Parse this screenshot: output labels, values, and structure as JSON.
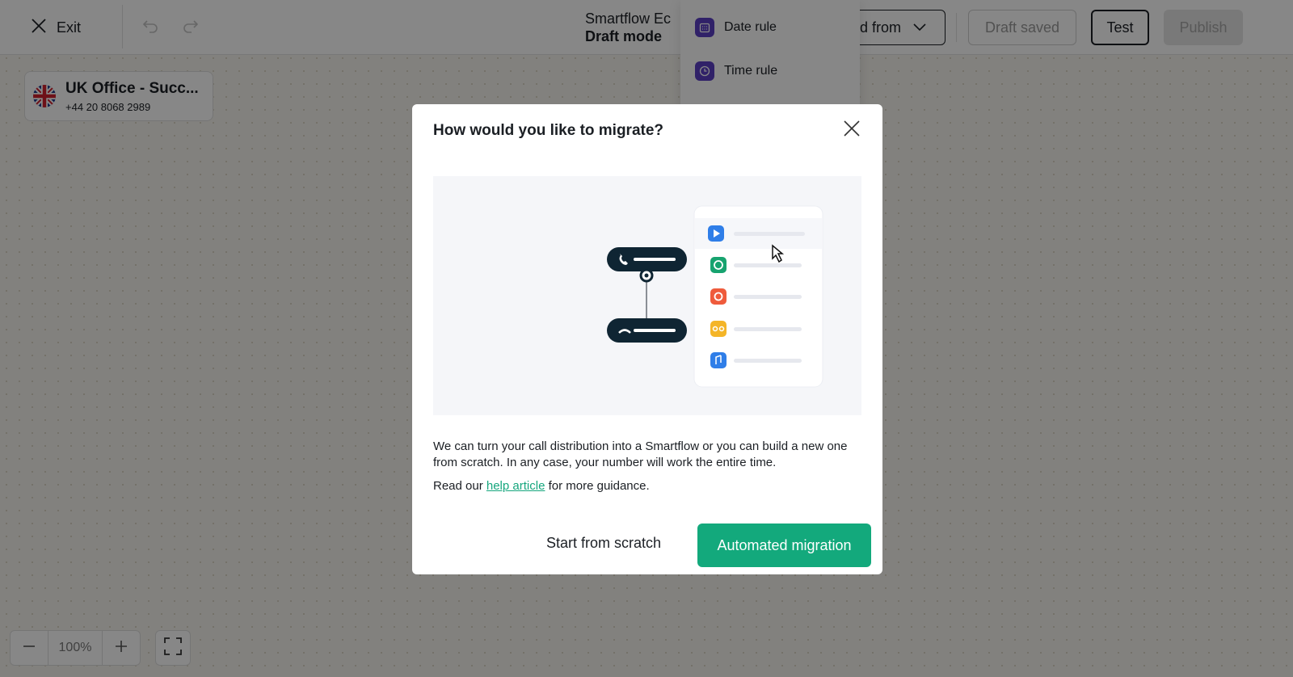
{
  "topbar": {
    "exit_label": "Exit",
    "title": "Smartflow Ec",
    "subtitle": "Draft mode",
    "build_from_label": "d from",
    "draft_saved_label": "Draft saved",
    "test_label": "Test",
    "publish_label": "Publish"
  },
  "dropdown": {
    "items": [
      {
        "label": "Date rule",
        "icon": "calendar-icon"
      },
      {
        "label": "Time rule",
        "icon": "clock-icon"
      }
    ]
  },
  "number_card": {
    "title": "UK Office - Succ...",
    "phone": "+44 20 8068 2989",
    "flag": "uk-flag-icon"
  },
  "zoom": {
    "value": "100%"
  },
  "modal": {
    "title": "How would you like to migrate?",
    "body_text": "We can turn your call distribution into a Smartflow or you can build a new one from scratch. In any case, your number will work the entire time.",
    "read_prefix": "Read our ",
    "help_link_label": "help article",
    "read_suffix": " for more guidance.",
    "scratch_label": "Start from scratch",
    "migrate_label": "Automated migration"
  },
  "colors": {
    "accent": "#13a97c",
    "dark_pill": "#0f2533",
    "rule_icon": "#5b3fc4",
    "canvas_bg": "#f6f4ee"
  }
}
